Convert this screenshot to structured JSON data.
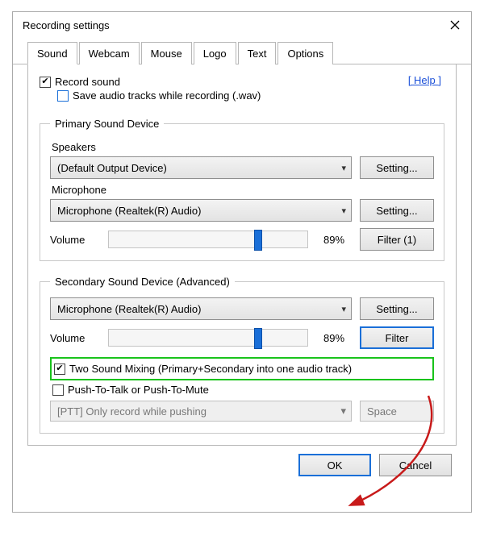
{
  "window": {
    "title": "Recording settings"
  },
  "tabs": [
    "Sound",
    "Webcam",
    "Mouse",
    "Logo",
    "Text",
    "Options"
  ],
  "help_label": "[ Help ]",
  "record_sound": {
    "label": "Record sound",
    "checked": true
  },
  "save_tracks": {
    "label": "Save audio tracks while recording (.wav)",
    "checked": false
  },
  "primary": {
    "legend": "Primary Sound Device",
    "speakers_label": "Speakers",
    "speakers_value": "(Default Output Device)",
    "speakers_setting": "Setting...",
    "mic_label": "Microphone",
    "mic_value": "Microphone (Realtek(R) Audio)",
    "mic_setting": "Setting...",
    "volume_label": "Volume",
    "volume_pct": "89%",
    "filter_label": "Filter (1)"
  },
  "secondary": {
    "legend": "Secondary Sound Device (Advanced)",
    "device_value": "Microphone (Realtek(R) Audio)",
    "device_setting": "Setting...",
    "volume_label": "Volume",
    "volume_pct": "89%",
    "filter_label": "Filter",
    "mixing": {
      "label": "Two Sound Mixing (Primary+Secondary into one audio track)",
      "checked": true
    },
    "ptt": {
      "label": "Push-To-Talk or Push-To-Mute",
      "checked": false
    },
    "ptt_mode": "[PTT] Only record while pushing",
    "ptt_key": "Space"
  },
  "buttons": {
    "ok": "OK",
    "cancel": "Cancel"
  }
}
